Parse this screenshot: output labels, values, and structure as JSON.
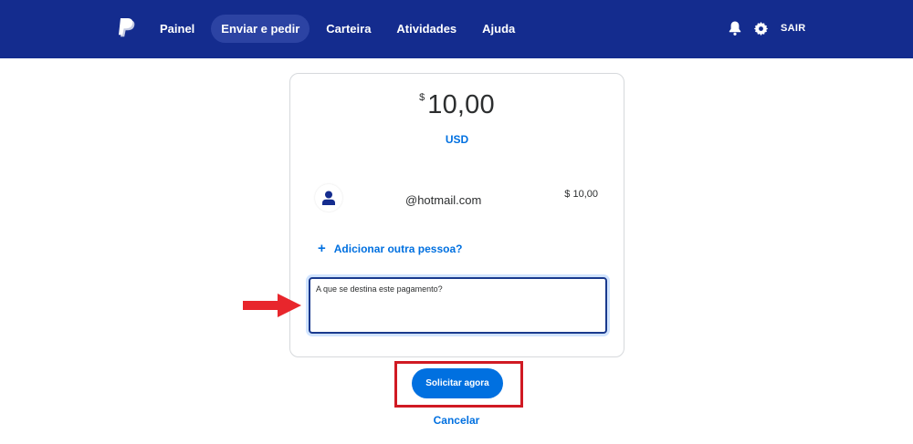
{
  "header": {
    "brand_color": "#142c8e",
    "logo_icon": "paypal-logo-icon",
    "nav": [
      {
        "label": "Painel"
      },
      {
        "label": "Enviar e pedir",
        "active": true
      },
      {
        "label": "Carteira"
      },
      {
        "label": "Atividades"
      },
      {
        "label": "Ajuda"
      }
    ],
    "icons": [
      "bell-icon",
      "gear-icon"
    ],
    "logout_label": "SAIR"
  },
  "request": {
    "currency_symbol": "$",
    "amount": "10,00",
    "currency_code": "USD",
    "recipient": {
      "avatar_icon": "person-icon",
      "email": "@hotmail.com",
      "amount": "$ 10,00"
    },
    "add_person_label": "Adicionar outra pessoa?",
    "note_placeholder": "A que se destina este pagamento?",
    "note_value": ""
  },
  "actions": {
    "submit_label": "Solicitar agora",
    "cancel_label": "Cancelar",
    "accent_color": "#0070e0"
  },
  "annotations": {
    "arrow_color": "#e8262c",
    "highlight_color": "#d01a23"
  }
}
